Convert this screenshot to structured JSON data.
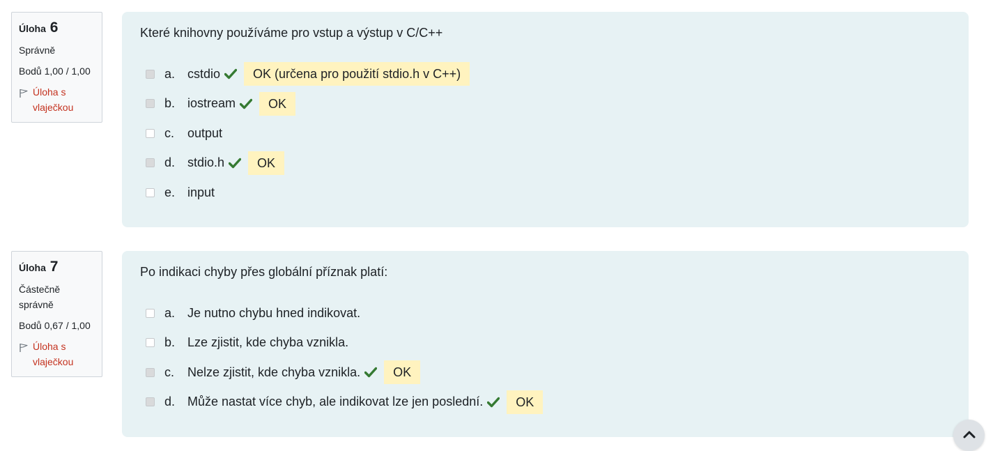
{
  "questions": [
    {
      "label": "Úloha",
      "number": "6",
      "state": "Správně",
      "grade": "Bodů 1,00 / 1,00",
      "flag": "Úloha s vlaječkou",
      "text": "Které knihovny používáme pro vstup a výstup v C/C++",
      "answers": [
        {
          "letter": "a.",
          "text": "cstdio",
          "checked": true,
          "correct": true,
          "feedback": "OK (určena pro použití stdio.h v C++)"
        },
        {
          "letter": "b.",
          "text": "iostream",
          "checked": true,
          "correct": true,
          "feedback": "OK"
        },
        {
          "letter": "c.",
          "text": "output",
          "checked": false,
          "correct": false,
          "feedback": ""
        },
        {
          "letter": "d.",
          "text": "stdio.h",
          "checked": true,
          "correct": true,
          "feedback": "OK"
        },
        {
          "letter": "e.",
          "text": "input",
          "checked": false,
          "correct": false,
          "feedback": ""
        }
      ]
    },
    {
      "label": "Úloha",
      "number": "7",
      "state": "Částečně správně",
      "grade": "Bodů 0,67 / 1,00",
      "flag": "Úloha s vlaječkou",
      "text": "Po indikaci chyby přes globální příznak platí:",
      "answers": [
        {
          "letter": "a.",
          "text": "Je nutno chybu hned indikovat.",
          "checked": false,
          "correct": false,
          "feedback": ""
        },
        {
          "letter": "b.",
          "text": "Lze zjistit, kde chyba vznikla.",
          "checked": false,
          "correct": false,
          "feedback": ""
        },
        {
          "letter": "c.",
          "text": "Nelze zjistit, kde chyba vznikla.",
          "checked": true,
          "correct": true,
          "feedback": "OK"
        },
        {
          "letter": "d.",
          "text": "Může nastat více chyb, ale indikovat lze jen poslední.",
          "checked": true,
          "correct": true,
          "feedback": "OK"
        }
      ]
    }
  ],
  "icons": {
    "flag": "flag-icon",
    "check": "check-icon",
    "scroll_top": "chevron-up-icon"
  },
  "colors": {
    "flag": "#c4321f",
    "check": "#357a32",
    "feedback_bg": "#fff3bf",
    "content_bg": "#e7f2f4"
  }
}
